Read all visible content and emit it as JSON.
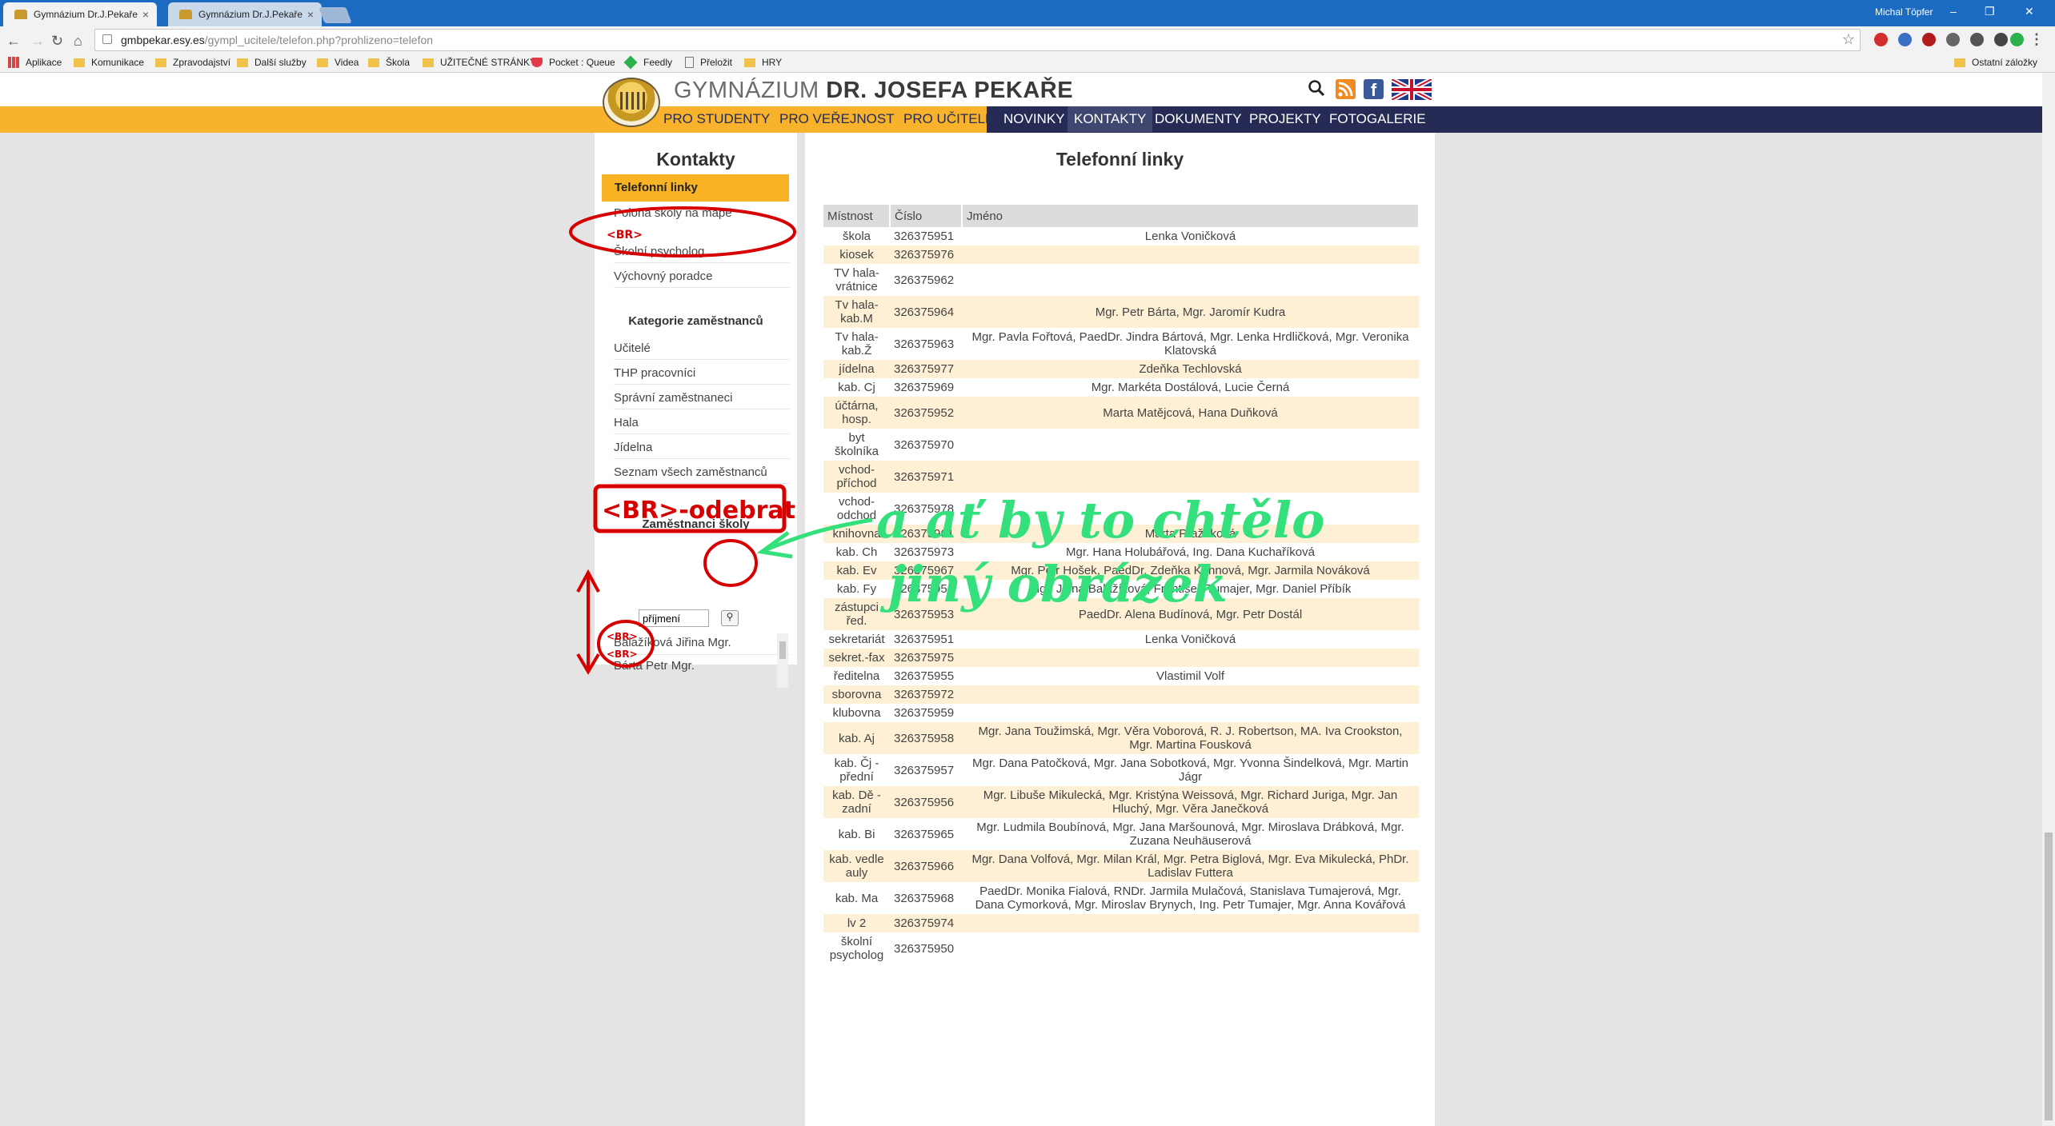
{
  "browser": {
    "tabs": [
      {
        "title": "Gymnázium Dr.J.Pekaře",
        "active": true
      },
      {
        "title": "Gymnázium Dr.J.Pekaře",
        "active": false
      }
    ],
    "profile": "Michal Töpfer",
    "url_host": "gmbpekar.esy.es",
    "url_path": "/gympl_ucitele/telefon.php?prohlizeno=telefon",
    "bookmarks": [
      "Aplikace",
      "Komunikace",
      "Zpravodajství",
      "Další služby",
      "Videa",
      "Škola",
      "UŽITEČNÉ STRÁNKY",
      "Pocket : Queue",
      "Feedly",
      "Přeložit",
      "HRY"
    ],
    "other_bookmarks": "Ostatní záložky"
  },
  "site": {
    "title_light": "GYMNÁZIUM",
    "title_bold": "DR. JOSEFA PEKAŘE",
    "nav": [
      "PRO STUDENTY",
      "PRO VEŘEJNOST",
      "PRO UČITELE",
      "NOVINKY",
      "KONTAKTY",
      "DOKUMENTY",
      "PROJEKTY",
      "FOTOGALERIE"
    ],
    "current_nav": "KONTAKTY"
  },
  "sidebar": {
    "heading": "Kontakty",
    "active_item": "Telefonní linky",
    "items": [
      "Poloha školy na mapě",
      "Školní psycholog",
      "Výchovný poradce"
    ],
    "category_heading": "Kategorie zaměstnanců",
    "categories": [
      "Učitelé",
      "THP pracovníci",
      "Správní zaměstnaneci",
      "Hala",
      "Jídelna",
      "Seznam všech zaměstnanců"
    ],
    "employees_heading": "Zaměstnanci školy",
    "search_value": "příjmení",
    "employees": [
      "Balažíková Jiřina Mgr.",
      "Bárta Petr Mgr."
    ]
  },
  "main": {
    "heading": "Telefonní linky",
    "columns": [
      "Místnost",
      "Číslo",
      "Jméno"
    ],
    "rows": [
      [
        "škola",
        "326375951",
        "Lenka Voničková"
      ],
      [
        "kiosek",
        "326375976",
        ""
      ],
      [
        "TV hala-vrátnice",
        "326375962",
        ""
      ],
      [
        "Tv hala-kab.M",
        "326375964",
        "Mgr. Petr Bárta, Mgr. Jaromír Kudra"
      ],
      [
        "Tv hala-kab.Ž",
        "326375963",
        "Mgr. Pavla Fořtová, PaedDr. Jindra Bártová, Mgr. Lenka Hrdličková, Mgr. Veronika Klatovská"
      ],
      [
        "jídelna",
        "326375977",
        "Zdeňka Techlovská"
      ],
      [
        "kab. Cj",
        "326375969",
        "Mgr. Markéta Dostálová, Lucie Černá"
      ],
      [
        "účtárna, hosp.",
        "326375952",
        "Marta Matějcová, Hana Duňková"
      ],
      [
        "byt školníka",
        "326375970",
        ""
      ],
      [
        "vchod-příchod",
        "326375971",
        ""
      ],
      [
        "vchod-odchod",
        "326375978",
        ""
      ],
      [
        "knihovna",
        "326375961",
        "Marta Pražáková"
      ],
      [
        "kab. Ch",
        "326375973",
        "Mgr. Hana Holubářová, Ing. Dana Kuchaříková"
      ],
      [
        "kab. Ev",
        "326375967",
        "Mgr. Petr Hošek, PaedDr. Zdeňka Kuhnová, Mgr. Jarmila Nováková"
      ],
      [
        "kab. Fy",
        "326375954",
        "Mgr. Jiřina Balažíková, František Tumajer, Mgr. Daniel Příbík"
      ],
      [
        "zástupci řed.",
        "326375953",
        "PaedDr. Alena Budínová, Mgr. Petr Dostál"
      ],
      [
        "sekretariát",
        "326375951",
        "Lenka Voničková"
      ],
      [
        "sekret.-fax",
        "326375975",
        ""
      ],
      [
        "ředitelna",
        "326375955",
        "Vlastimil Volf"
      ],
      [
        "sborovna",
        "326375972",
        ""
      ],
      [
        "klubovna",
        "326375959",
        ""
      ],
      [
        "kab. Aj",
        "326375958",
        "Mgr. Jana Toužimská, Mgr. Věra Voborová, R. J. Robertson, MA. Iva Crookston, Mgr. Martina Fousková"
      ],
      [
        "kab. Čj - přední",
        "326375957",
        "Mgr. Dana Patočková, Mgr. Jana Sobotková, Mgr. Yvonna Šindelková, Mgr. Martin Jágr"
      ],
      [
        "kab. Dě - zadní",
        "326375956",
        "Mgr. Libuše Mikulecká, Mgr. Kristýna Weissová, Mgr. Richard Juriga, Mgr. Jan Hluchý, Mgr. Věra Janečková"
      ],
      [
        "kab. Bi",
        "326375965",
        "Mgr. Ludmila Boubínová, Mgr. Jana Maršounová, Mgr. Miroslava Drábková, Mgr. Zuzana Neuhäuserová"
      ],
      [
        "kab. vedle auly",
        "326375966",
        "Mgr. Dana Volfová, Mgr. Milan Král, Mgr. Petra Biglová, Mgr. Eva Mikulecká, PhDr. Ladislav Futtera"
      ],
      [
        "kab. Ma",
        "326375968",
        "PaedDr. Monika Fialová, RNDr. Jarmila Mulačová, Stanislava Tumajerová, Mgr. Dana Cymorková, Mgr. Miroslav Brynych, Ing. Petr Tumajer, Mgr. Anna Kovářová"
      ],
      [
        "lv 2",
        "326375974",
        ""
      ],
      [
        "školní psycholog",
        "326375950",
        ""
      ]
    ]
  },
  "annotations": {
    "br_small": "<BR>",
    "br_remove": "<BR>-odebrat",
    "br_double_1": "<BR>",
    "br_double_2": "<BR>",
    "green_line_1": "a ať by to chtělo",
    "green_line_2": "jiný obrázek",
    "red_color": "#d60000",
    "green_color": "#34e07b"
  }
}
